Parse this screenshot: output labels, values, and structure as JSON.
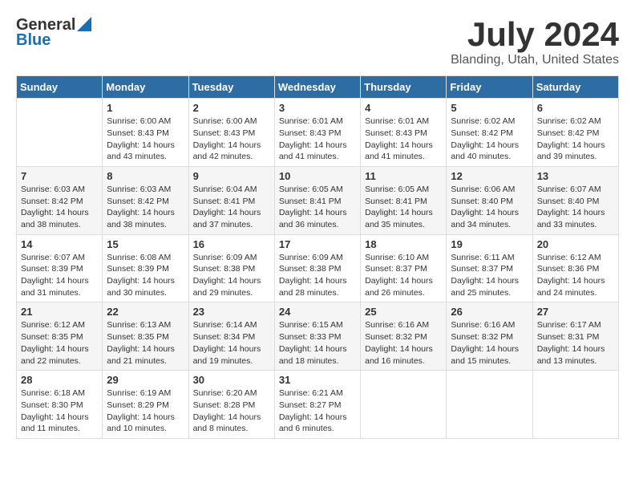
{
  "header": {
    "logo_general": "General",
    "logo_blue": "Blue",
    "month_year": "July 2024",
    "location": "Blanding, Utah, United States"
  },
  "calendar": {
    "days_of_week": [
      "Sunday",
      "Monday",
      "Tuesday",
      "Wednesday",
      "Thursday",
      "Friday",
      "Saturday"
    ],
    "weeks": [
      [
        {
          "day": "",
          "info": ""
        },
        {
          "day": "1",
          "info": "Sunrise: 6:00 AM\nSunset: 8:43 PM\nDaylight: 14 hours\nand 43 minutes."
        },
        {
          "day": "2",
          "info": "Sunrise: 6:00 AM\nSunset: 8:43 PM\nDaylight: 14 hours\nand 42 minutes."
        },
        {
          "day": "3",
          "info": "Sunrise: 6:01 AM\nSunset: 8:43 PM\nDaylight: 14 hours\nand 41 minutes."
        },
        {
          "day": "4",
          "info": "Sunrise: 6:01 AM\nSunset: 8:43 PM\nDaylight: 14 hours\nand 41 minutes."
        },
        {
          "day": "5",
          "info": "Sunrise: 6:02 AM\nSunset: 8:42 PM\nDaylight: 14 hours\nand 40 minutes."
        },
        {
          "day": "6",
          "info": "Sunrise: 6:02 AM\nSunset: 8:42 PM\nDaylight: 14 hours\nand 39 minutes."
        }
      ],
      [
        {
          "day": "7",
          "info": "Sunrise: 6:03 AM\nSunset: 8:42 PM\nDaylight: 14 hours\nand 38 minutes."
        },
        {
          "day": "8",
          "info": "Sunrise: 6:03 AM\nSunset: 8:42 PM\nDaylight: 14 hours\nand 38 minutes."
        },
        {
          "day": "9",
          "info": "Sunrise: 6:04 AM\nSunset: 8:41 PM\nDaylight: 14 hours\nand 37 minutes."
        },
        {
          "day": "10",
          "info": "Sunrise: 6:05 AM\nSunset: 8:41 PM\nDaylight: 14 hours\nand 36 minutes."
        },
        {
          "day": "11",
          "info": "Sunrise: 6:05 AM\nSunset: 8:41 PM\nDaylight: 14 hours\nand 35 minutes."
        },
        {
          "day": "12",
          "info": "Sunrise: 6:06 AM\nSunset: 8:40 PM\nDaylight: 14 hours\nand 34 minutes."
        },
        {
          "day": "13",
          "info": "Sunrise: 6:07 AM\nSunset: 8:40 PM\nDaylight: 14 hours\nand 33 minutes."
        }
      ],
      [
        {
          "day": "14",
          "info": "Sunrise: 6:07 AM\nSunset: 8:39 PM\nDaylight: 14 hours\nand 31 minutes."
        },
        {
          "day": "15",
          "info": "Sunrise: 6:08 AM\nSunset: 8:39 PM\nDaylight: 14 hours\nand 30 minutes."
        },
        {
          "day": "16",
          "info": "Sunrise: 6:09 AM\nSunset: 8:38 PM\nDaylight: 14 hours\nand 29 minutes."
        },
        {
          "day": "17",
          "info": "Sunrise: 6:09 AM\nSunset: 8:38 PM\nDaylight: 14 hours\nand 28 minutes."
        },
        {
          "day": "18",
          "info": "Sunrise: 6:10 AM\nSunset: 8:37 PM\nDaylight: 14 hours\nand 26 minutes."
        },
        {
          "day": "19",
          "info": "Sunrise: 6:11 AM\nSunset: 8:37 PM\nDaylight: 14 hours\nand 25 minutes."
        },
        {
          "day": "20",
          "info": "Sunrise: 6:12 AM\nSunset: 8:36 PM\nDaylight: 14 hours\nand 24 minutes."
        }
      ],
      [
        {
          "day": "21",
          "info": "Sunrise: 6:12 AM\nSunset: 8:35 PM\nDaylight: 14 hours\nand 22 minutes."
        },
        {
          "day": "22",
          "info": "Sunrise: 6:13 AM\nSunset: 8:35 PM\nDaylight: 14 hours\nand 21 minutes."
        },
        {
          "day": "23",
          "info": "Sunrise: 6:14 AM\nSunset: 8:34 PM\nDaylight: 14 hours\nand 19 minutes."
        },
        {
          "day": "24",
          "info": "Sunrise: 6:15 AM\nSunset: 8:33 PM\nDaylight: 14 hours\nand 18 minutes."
        },
        {
          "day": "25",
          "info": "Sunrise: 6:16 AM\nSunset: 8:32 PM\nDaylight: 14 hours\nand 16 minutes."
        },
        {
          "day": "26",
          "info": "Sunrise: 6:16 AM\nSunset: 8:32 PM\nDaylight: 14 hours\nand 15 minutes."
        },
        {
          "day": "27",
          "info": "Sunrise: 6:17 AM\nSunset: 8:31 PM\nDaylight: 14 hours\nand 13 minutes."
        }
      ],
      [
        {
          "day": "28",
          "info": "Sunrise: 6:18 AM\nSunset: 8:30 PM\nDaylight: 14 hours\nand 11 minutes."
        },
        {
          "day": "29",
          "info": "Sunrise: 6:19 AM\nSunset: 8:29 PM\nDaylight: 14 hours\nand 10 minutes."
        },
        {
          "day": "30",
          "info": "Sunrise: 6:20 AM\nSunset: 8:28 PM\nDaylight: 14 hours\nand 8 minutes."
        },
        {
          "day": "31",
          "info": "Sunrise: 6:21 AM\nSunset: 8:27 PM\nDaylight: 14 hours\nand 6 minutes."
        },
        {
          "day": "",
          "info": ""
        },
        {
          "day": "",
          "info": ""
        },
        {
          "day": "",
          "info": ""
        }
      ]
    ]
  }
}
